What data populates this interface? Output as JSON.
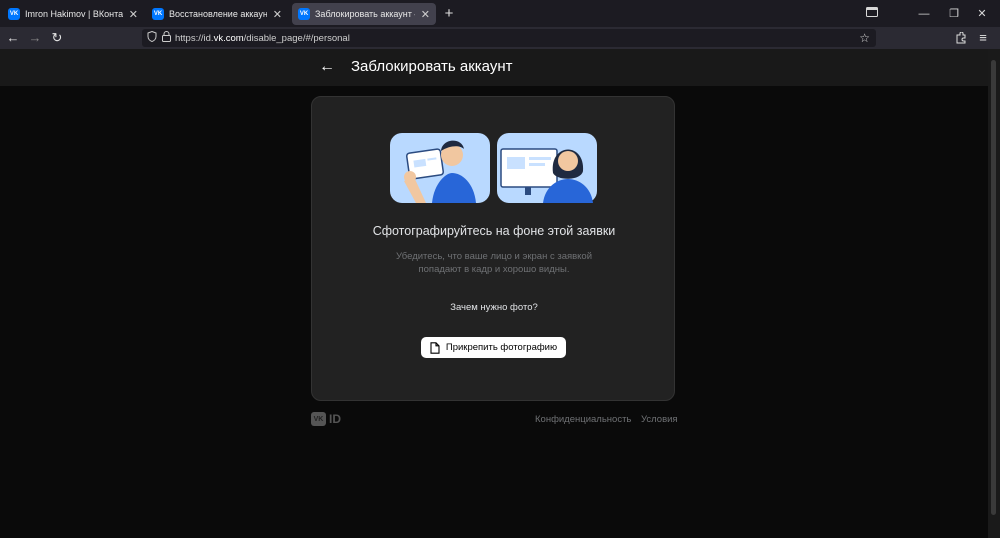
{
  "browser": {
    "tabs": [
      {
        "label": "Imron Hakimov | ВКонтакте",
        "favicon": "VK"
      },
      {
        "label": "Восстановление аккаунта VK I",
        "favicon": "VK"
      },
      {
        "label": "Заблокировать аккаунт — VK I",
        "favicon": "VK"
      }
    ],
    "url_prefix": "https://id.",
    "url_domain": "vk.com",
    "url_path": "/disable_page/#/personal"
  },
  "page": {
    "title": "Заблокировать аккаунт",
    "card": {
      "heading": "Сфотографируйтесь на фоне этой заявки",
      "description": "Убедитесь, что ваше лицо и экран с заявкой попадают в кадр и хорошо видны.",
      "why_link": "Зачем нужно фото?",
      "attach_button": "Прикрепить фотографию"
    },
    "footer": {
      "logo_badge": "VK",
      "logo_text": "ID",
      "privacy": "Конфиденциальность",
      "terms": "Условия"
    }
  },
  "colors": {
    "vk_blue": "#0077ff",
    "illustration_bg": "#b9d9ff",
    "card_bg": "#222222"
  }
}
